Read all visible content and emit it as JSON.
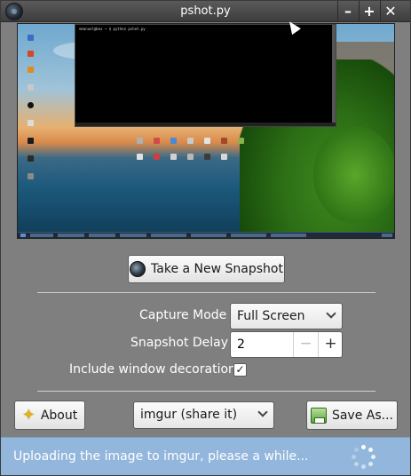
{
  "window": {
    "title": "pshot.py"
  },
  "titlebar": {
    "minimize_label": "–",
    "maximize_label": "+",
    "close_label": "✕"
  },
  "preview": {
    "terminal_text": "emanuel@box ~ $ python pshot.py"
  },
  "main": {
    "snapshot_button": "Take a New Snapshot",
    "capture_mode_label": "Capture Mode",
    "capture_mode_value": "Full Screen",
    "snapshot_delay_label": "Snapshot Delay",
    "snapshot_delay_value": "2",
    "spin_minus": "−",
    "spin_plus": "+",
    "include_decorations_label": "Include window decorations",
    "include_decorations_checked": true,
    "check_mark": "✓"
  },
  "footer": {
    "about_label": "About",
    "about_icon": "star-icon",
    "upload_service": "imgur (share it)",
    "save_label": "Save As...",
    "save_icon": "save-icon"
  },
  "status": {
    "message": "Uploading the image to imgur, please a while..."
  },
  "colors": {
    "window_bg": "#7f7f7f",
    "status_bg": "#92b6dc",
    "titlebar": "#3d3d3d"
  }
}
